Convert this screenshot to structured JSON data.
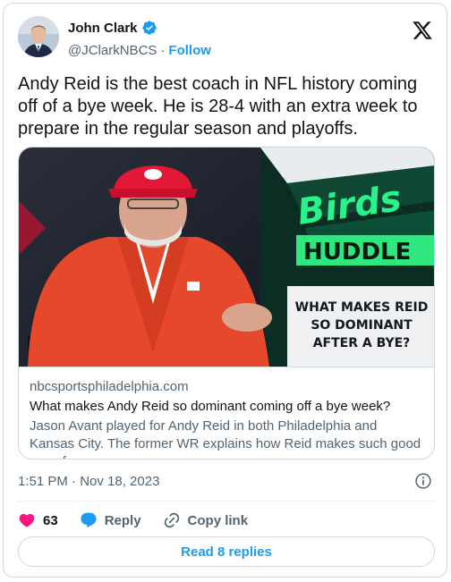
{
  "author": {
    "display_name": "John Clark",
    "handle": "@JClarkNBCS",
    "separator": "·",
    "follow_label": "Follow",
    "verified_icon": "verified-badge-icon"
  },
  "tweet": {
    "text": "Andy Reid is the best coach in NFL history coming off of a bye week. He is 28-4 with an extra week to prepare in the regular season and playoffs."
  },
  "link_card": {
    "image_text": {
      "line1": "Birds",
      "line2": "HUDDLE",
      "line3": "WHAT MAKES REID",
      "line4": "SO DOMINANT",
      "line5": "AFTER A BYE?"
    },
    "domain": "nbcsportsphiladelphia.com",
    "title": "What makes Andy Reid so dominant coming off a bye week?",
    "description": "Jason Avant played for Andy Reid in both Philadelphia and Kansas City. The former WR explains how Reid makes such good use of ..."
  },
  "meta": {
    "timestamp": "1:51 PM · Nov 18, 2023"
  },
  "actions": {
    "like_count": "63",
    "reply_label": "Reply",
    "copy_link_label": "Copy link"
  },
  "replies_button": {
    "label": "Read 8 replies"
  },
  "colors": {
    "accent": "#1d9bf0",
    "like": "#f91880",
    "text": "#0f1419",
    "secondary": "#536471",
    "border": "#cfd9de"
  }
}
